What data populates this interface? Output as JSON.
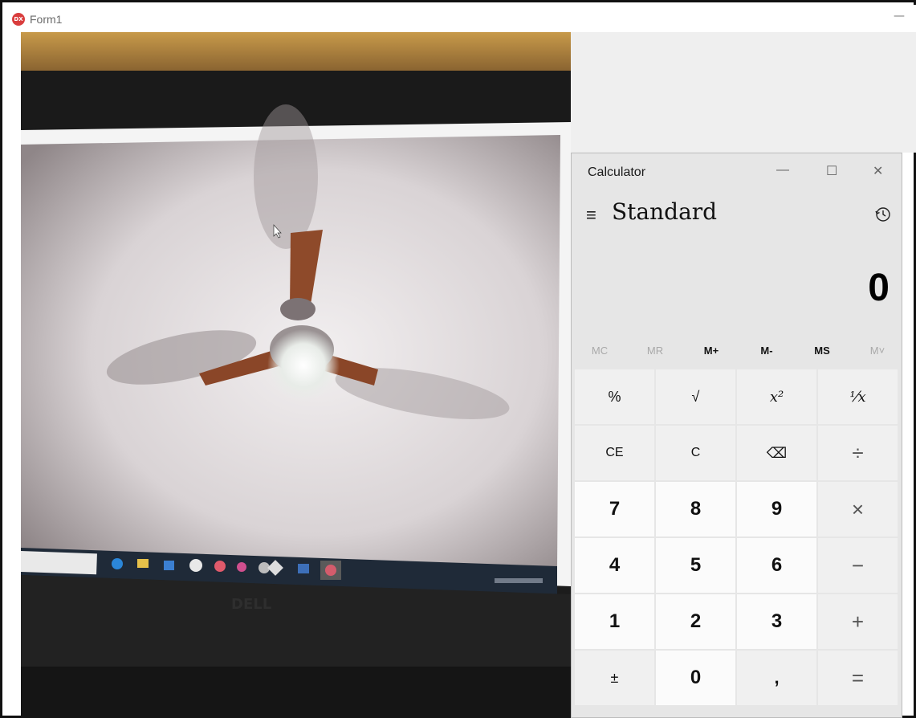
{
  "form": {
    "title": "Form1",
    "logo_text": "DX",
    "minimize_glyph": "—"
  },
  "camera": {
    "description_icon": "camera-feed-image"
  },
  "calculator": {
    "title": "Calculator",
    "mode": "Standard",
    "display": "0",
    "window_buttons": {
      "minimize": "—",
      "maximize": "☐",
      "close": "✕"
    },
    "icons": {
      "menu": "hamburger-icon",
      "history": "history-icon"
    },
    "memory": [
      "MC",
      "MR",
      "M+",
      "M-",
      "MS",
      "M˅"
    ],
    "keys": {
      "percent": "%",
      "sqrt": "√",
      "square": "x²",
      "reciprocal": "⅟x",
      "ce": "CE",
      "c": "C",
      "backspace": "⌫",
      "divide": "÷",
      "n7": "7",
      "n8": "8",
      "n9": "9",
      "multiply": "×",
      "n4": "4",
      "n5": "5",
      "n6": "6",
      "minus": "−",
      "n1": "1",
      "n2": "2",
      "n3": "3",
      "plus": "+",
      "negate": "±",
      "n0": "0",
      "decimal": ",",
      "equals": "="
    }
  }
}
